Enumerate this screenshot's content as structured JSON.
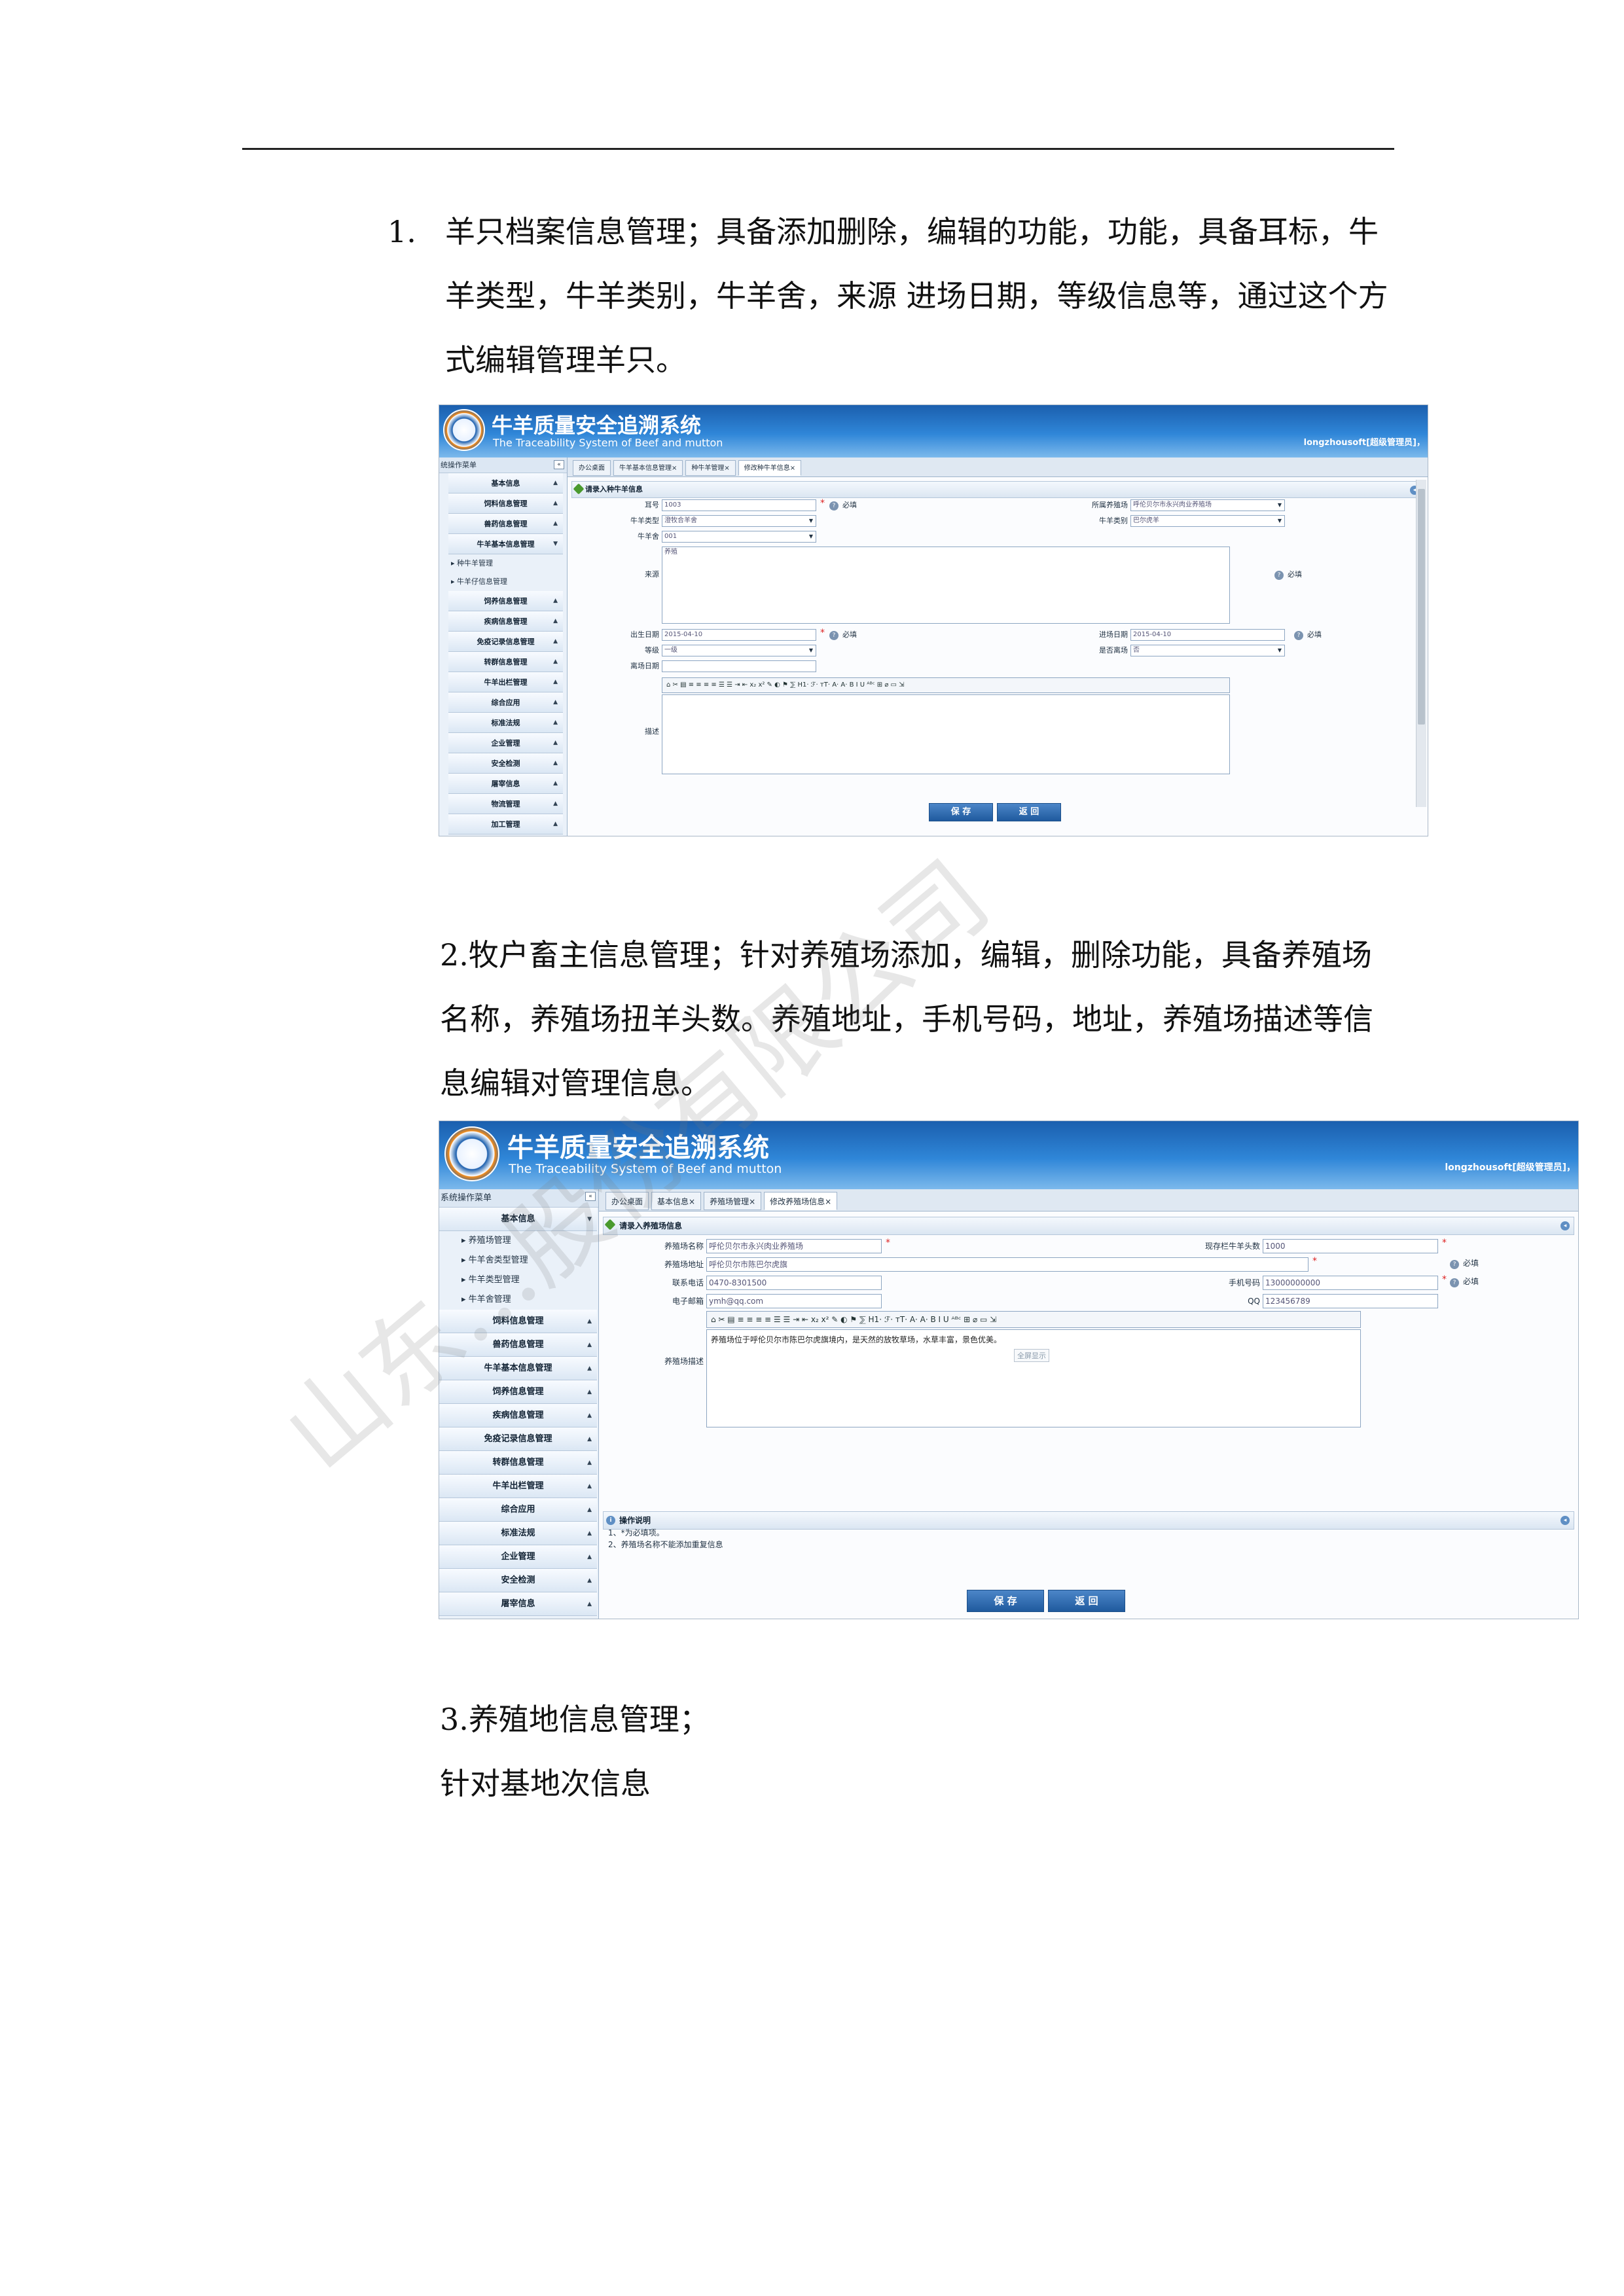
{
  "paragraphs": {
    "p1_number": "1.",
    "p1": "羊只档案信息管理；具备添加删除，编辑的功能，功能，具备耳标，牛羊类型，牛羊类别，牛羊舍，来源 进场日期，等级信息等，通过这个方式编辑管理羊只。",
    "p2": "2.牧户畜主信息管理；针对养殖场添加，编辑，删除功能，具备养殖场名称，养殖场扭羊头数。养殖地址，手机号码，地址，养殖场描述等信息编辑对管理信息。",
    "p3": "3.养殖地信息管理；",
    "p4": "针对基地次信息"
  },
  "watermark": "山东...股份有限公司",
  "system": {
    "title": "牛羊质量安全追溯系统",
    "subtitle": "The Traceability System of Beef and mutton",
    "user": "longzhousoft[超级管理员]，",
    "sidebar_header": "系统操作菜单",
    "collapse_symbol": "«"
  },
  "shot1": {
    "sidebar_header": "统操作菜单",
    "menu": [
      "基本信息",
      "饲料信息管理",
      "兽药信息管理",
      "牛羊基本信息管理"
    ],
    "submenu": [
      "种牛羊管理",
      "牛羊仔信息管理"
    ],
    "menu2": [
      "饲养信息管理",
      "疾病信息管理",
      "免疫记录信息管理",
      "转群信息管理",
      "牛羊出栏管理",
      "综合应用",
      "标准法规",
      "企业管理",
      "安全检测",
      "屠宰信息",
      "物流管理",
      "加工管理"
    ],
    "tabs": [
      "办公桌面",
      "牛羊基本信息管理×",
      "种牛羊管理×",
      "修改种牛羊信息×"
    ],
    "panel_title": "请录入种牛羊信息",
    "labels": {
      "ear": "耳号",
      "farm": "所属养殖场",
      "type": "牛羊类型",
      "category": "牛羊类别",
      "shed": "牛羊舍",
      "source": "来源",
      "birth": "出生日期",
      "entry": "进场日期",
      "grade": "等级",
      "pregnant": "是否离场",
      "leave": "离场日期",
      "desc": "描述"
    },
    "values": {
      "ear": "1003",
      "farm": "呼伦贝尔市永兴肉业养殖场",
      "type": "澄牧合羊舍",
      "category": "巴尔虎羊",
      "shed": "001",
      "source": "养殖",
      "birth": "2015-04-10",
      "entry": "2015-04-10",
      "grade": "一级",
      "pregnant": "否"
    },
    "required": "必填",
    "toolbar": "⌂ ✂ ▤ ≡ ≡ ≡ ≡ ☰ ☰ ⇥ ⇤ x₂ x² ✎ ◐ ⚑ ⅀ H1· ℱ· ᴛT· A· A· B I U ᴬᴮᶜ ⊞ ⌀ ▭ ⇲",
    "save": "保 存",
    "back": "返 回"
  },
  "shot2": {
    "menu_top": "基本信息",
    "submenu": [
      "养殖场管理",
      "牛羊舍类型管理",
      "牛羊类型管理",
      "牛羊舍管理"
    ],
    "menu": [
      "饲料信息管理",
      "兽药信息管理",
      "牛羊基本信息管理",
      "饲养信息管理",
      "疾病信息管理",
      "免疫记录信息管理",
      "转群信息管理",
      "牛羊出栏管理",
      "综合应用",
      "标准法规",
      "企业管理",
      "安全检测",
      "屠宰信息"
    ],
    "tabs": [
      "办公桌面",
      "基本信息×",
      "养殖场管理×",
      "修改养殖场信息×"
    ],
    "panel_title": "请录入养殖场信息",
    "labels": {
      "name": "养殖场名称",
      "count": "现存栏牛羊头数",
      "address": "养殖场地址",
      "phone": "联系电话",
      "mobile": "手机号码",
      "email": "电子邮箱",
      "qq": "QQ",
      "desc": "养殖场描述"
    },
    "values": {
      "name": "呼伦贝尔市永兴肉业养殖场",
      "count": "1000",
      "address": "呼伦贝尔市陈巴尔虎旗",
      "phone": "0470-8301500",
      "mobile": "13000000000",
      "email": "ymh@qq.com",
      "qq": "123456789"
    },
    "required": "必填",
    "toolbar": "⌂ ✂ ▤ ≡ ≡ ≡ ≡ ☰ ☰ ⇥ ⇤ x₂ x² ✎ ◐ ⚑ ⅀ H1· ℱ· ᴛT· A· A· B I U ᴬᴮᶜ ⊞ ⌀ ▭ ⇲",
    "editor_text": "养殖场位于呼伦贝尔市陈巴尔虎旗境内，是天然的放牧草场，水草丰富，景色优美。",
    "tooltip": "全屏显示",
    "help_title": "操作说明",
    "help_lines": [
      "1、*为必填项。",
      "2、养殖场名称不能添加重复信息"
    ],
    "save": "保 存",
    "back": "返 回"
  }
}
